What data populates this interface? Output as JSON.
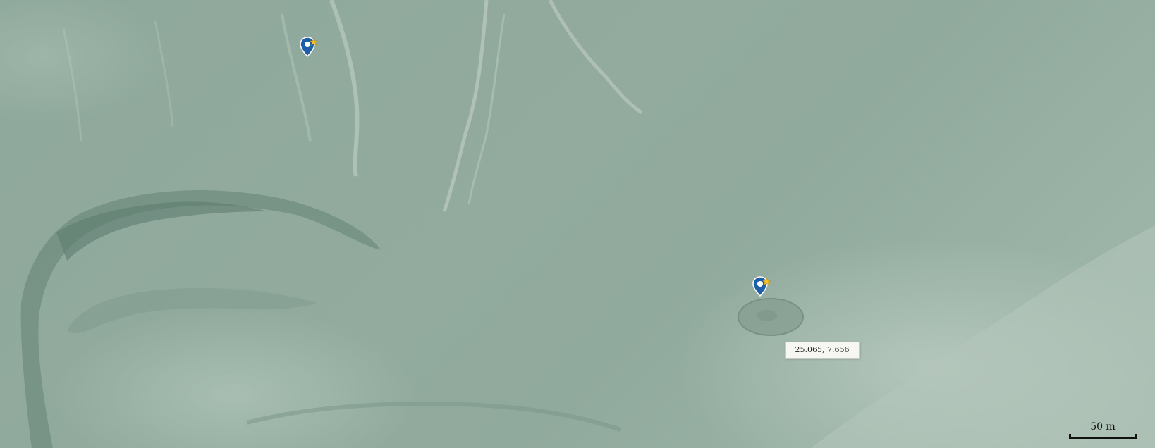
{
  "map": {
    "view": "satellite",
    "markers": [
      {
        "name": "marker-1",
        "icon": "map-pin-star-icon",
        "color": "#1f5fa8",
        "star_color": "#f2c12e"
      },
      {
        "name": "marker-2",
        "icon": "map-pin-star-icon",
        "color": "#1f5fa8",
        "star_color": "#f2c12e"
      }
    ],
    "coordinate_label": "25.065, 7.656",
    "scale": {
      "label": "50 m"
    }
  }
}
